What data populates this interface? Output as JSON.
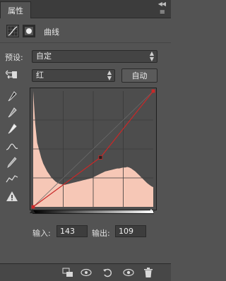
{
  "panel": {
    "tab_label": "属性",
    "collapse_glyph": "◀◀",
    "menu_glyph": "≡",
    "title": "曲线"
  },
  "preset": {
    "label": "预设:",
    "value": "自定"
  },
  "channel": {
    "value": "红",
    "auto_label": "自动"
  },
  "curve": {
    "points": [
      [
        0,
        0
      ],
      [
        143,
        109
      ],
      [
        255,
        255
      ]
    ],
    "selected_point": [
      143,
      109
    ],
    "histogram": [
      235,
      170,
      130,
      115,
      100,
      88,
      80,
      72,
      66,
      60,
      56,
      52,
      49,
      47,
      46,
      45,
      45,
      46,
      47,
      48,
      49,
      50,
      51,
      52,
      53,
      54,
      55,
      56,
      57,
      58,
      60,
      62,
      64,
      66,
      68,
      70,
      72,
      73,
      74,
      75,
      76,
      77,
      78,
      78,
      79,
      80,
      80,
      81,
      80,
      78,
      75,
      72,
      68,
      64,
      60,
      56,
      52,
      48,
      45,
      42,
      40
    ],
    "curve_color": "#c82828",
    "histogram_color": "#f6c7b6"
  },
  "io": {
    "input_label": "输入:",
    "input_value": "143",
    "output_label": "输出:",
    "output_value": "109"
  }
}
